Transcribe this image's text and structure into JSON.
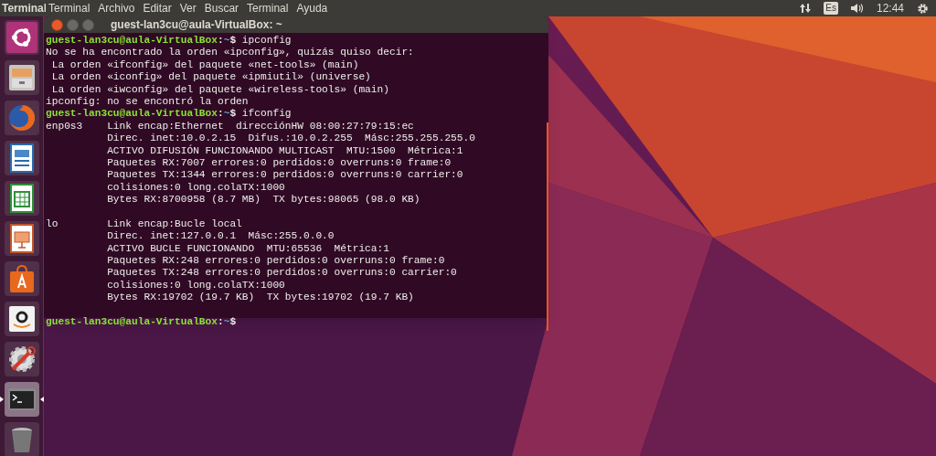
{
  "top_bar": {
    "app_title": "Terminal",
    "menu": [
      "Terminal",
      "Archivo",
      "Editar",
      "Ver",
      "Buscar",
      "Terminal",
      "Ayuda"
    ],
    "keyboard_layout": "Es",
    "clock": "12:44"
  },
  "launcher": {
    "items": [
      {
        "kind": "ubuntu",
        "selected": false
      },
      {
        "kind": "files",
        "selected": false
      },
      {
        "kind": "firefox",
        "selected": false
      },
      {
        "kind": "writer",
        "selected": false
      },
      {
        "kind": "calc",
        "selected": false
      },
      {
        "kind": "impress",
        "selected": false
      },
      {
        "kind": "software",
        "selected": false
      },
      {
        "kind": "amazon",
        "selected": false
      },
      {
        "kind": "settings",
        "selected": false
      },
      {
        "kind": "terminal",
        "selected": true
      },
      {
        "kind": "trash",
        "selected": false
      }
    ]
  },
  "window": {
    "title": "guest-lan3cu@aula-VirtualBox: ~",
    "lines": [
      {
        "kind": "prompt",
        "user": "guest-lan3cu@aula-VirtualBox",
        "separator": ":",
        "path": "~",
        "symbol": "$",
        "command": "ipconfig"
      },
      {
        "kind": "output",
        "text": "No se ha encontrado la orden «ipconfig», quizás quiso decir:"
      },
      {
        "kind": "output",
        "text": " La orden «ifconfig» del paquete «net-tools» (main)"
      },
      {
        "kind": "output",
        "text": " La orden «iconfig» del paquete «ipmiutil» (universe)"
      },
      {
        "kind": "output",
        "text": " La orden «iwconfig» del paquete «wireless-tools» (main)"
      },
      {
        "kind": "output",
        "text": "ipconfig: no se encontró la orden"
      },
      {
        "kind": "prompt",
        "user": "guest-lan3cu@aula-VirtualBox",
        "separator": ":",
        "path": "~",
        "symbol": "$",
        "command": "ifconfig"
      },
      {
        "kind": "output",
        "text": "enp0s3    Link encap:Ethernet  direcciónHW 08:00:27:79:15:ec"
      },
      {
        "kind": "output",
        "text": "          Direc. inet:10.0.2.15  Difus.:10.0.2.255  Másc:255.255.255.0"
      },
      {
        "kind": "output",
        "text": "          ACTIVO DIFUSIÓN FUNCIONANDO MULTICAST  MTU:1500  Métrica:1"
      },
      {
        "kind": "output",
        "text": "          Paquetes RX:7007 errores:0 perdidos:0 overruns:0 frame:0"
      },
      {
        "kind": "output",
        "text": "          Paquetes TX:1344 errores:0 perdidos:0 overruns:0 carrier:0"
      },
      {
        "kind": "output",
        "text": "          colisiones:0 long.colaTX:1000"
      },
      {
        "kind": "output",
        "text": "          Bytes RX:8700958 (8.7 MB)  TX bytes:98065 (98.0 KB)"
      },
      {
        "kind": "blank"
      },
      {
        "kind": "output",
        "text": "lo        Link encap:Bucle local"
      },
      {
        "kind": "output",
        "text": "          Direc. inet:127.0.0.1  Másc:255.0.0.0"
      },
      {
        "kind": "output",
        "text": "          ACTIVO BUCLE FUNCIONANDO  MTU:65536  Métrica:1"
      },
      {
        "kind": "output",
        "text": "          Paquetes RX:248 errores:0 perdidos:0 overruns:0 frame:0"
      },
      {
        "kind": "output",
        "text": "          Paquetes TX:248 errores:0 perdidos:0 overruns:0 carrier:0"
      },
      {
        "kind": "output",
        "text": "          colisiones:0 long.colaTX:1000"
      },
      {
        "kind": "output",
        "text": "          Bytes RX:19702 (19.7 KB)  TX bytes:19702 (19.7 KB)"
      },
      {
        "kind": "blank"
      },
      {
        "kind": "prompt",
        "user": "guest-lan3cu@aula-VirtualBox",
        "separator": ":",
        "path": "~",
        "symbol": "$"
      }
    ]
  }
}
